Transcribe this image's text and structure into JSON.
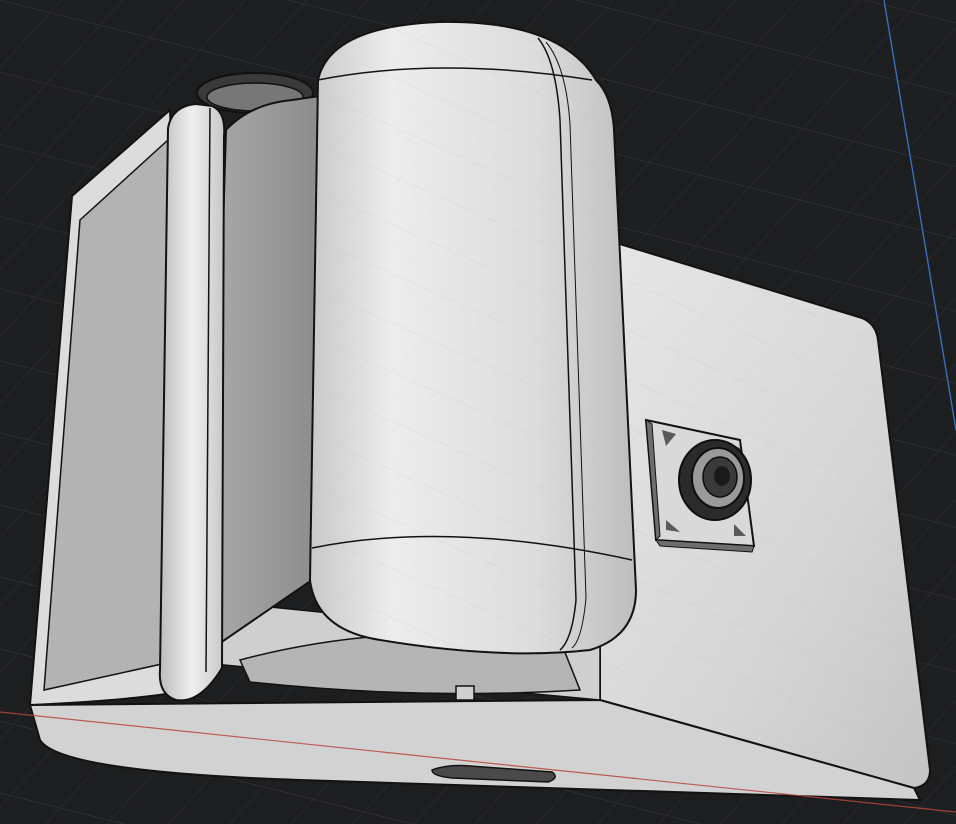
{
  "scene": {
    "type": "3d-cad-viewport",
    "subject": "camera-enclosure-model",
    "colors": {
      "background": "#1d1e20",
      "grid": "#3a3b3e",
      "x_axis": "#b8463c",
      "y_axis": "#3b6fb6",
      "body_light": "#e3e3e3",
      "body_mid": "#c9c9c9",
      "body_dark": "#8e8e8e",
      "edge": "#121212"
    },
    "grid_visible": true,
    "parts": [
      "housing",
      "cylinder-top",
      "side-panel",
      "camera-module",
      "lens",
      "bottom-slot"
    ]
  }
}
